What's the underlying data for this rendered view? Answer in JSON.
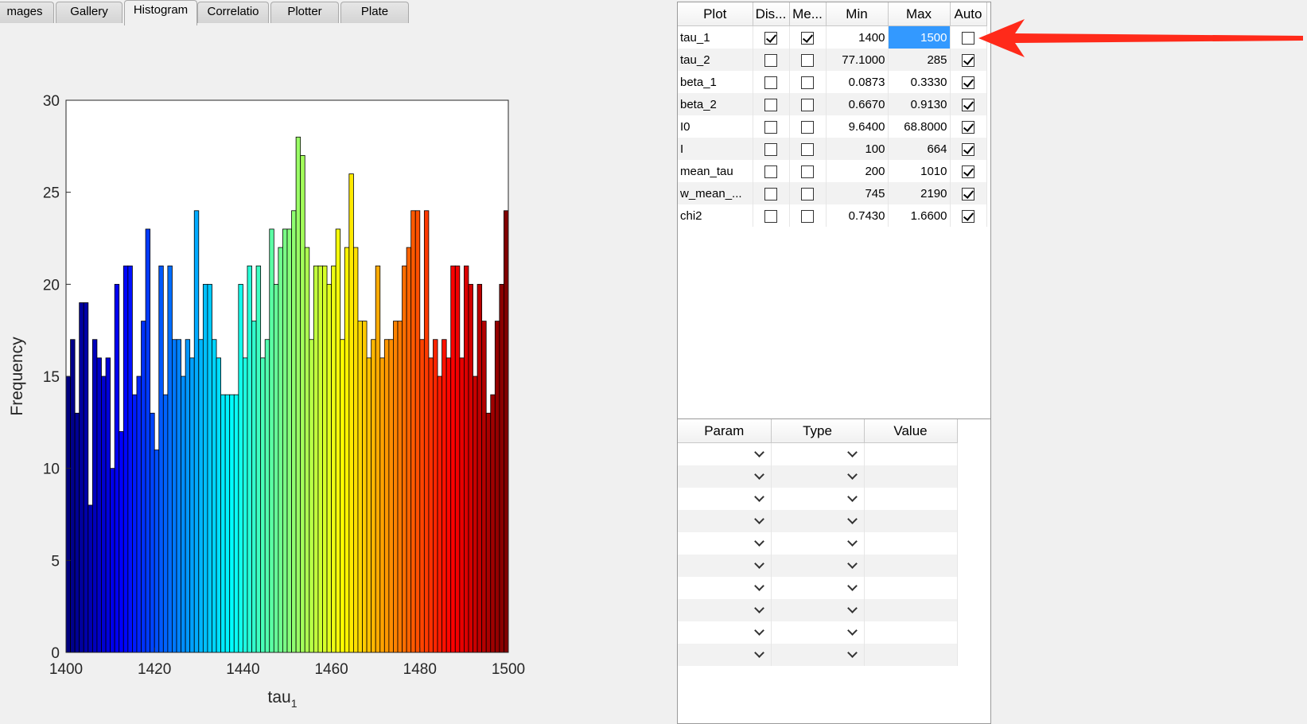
{
  "tabs": [
    {
      "label": "mages",
      "active": false
    },
    {
      "label": "Gallery",
      "active": false
    },
    {
      "label": "Histogram",
      "active": true
    },
    {
      "label": "Correlatio",
      "active": false
    },
    {
      "label": "Plotter",
      "active": false
    },
    {
      "label": "Plate",
      "active": false
    }
  ],
  "chart_data": {
    "type": "bar",
    "xlabel": "tau",
    "xlabel_subscript": "1",
    "ylabel": "Frequency",
    "xlim": [
      1400,
      1500
    ],
    "ylim": [
      0,
      30
    ],
    "xticks": [
      "1400",
      "1420",
      "1440",
      "1460",
      "1480",
      "1500"
    ],
    "yticks": [
      "0",
      "5",
      "10",
      "15",
      "20",
      "25",
      "30"
    ],
    "colormap": "jet",
    "bin_width": 1,
    "bin_start": 1400,
    "values": [
      15,
      17,
      13,
      19,
      19,
      8,
      17,
      16,
      15,
      16,
      10,
      20,
      12,
      21,
      21,
      14,
      15,
      18,
      23,
      13,
      11,
      21,
      14,
      21,
      17,
      17,
      15,
      17,
      16,
      24,
      17,
      20,
      20,
      17,
      16,
      14,
      14,
      14,
      14,
      20,
      16,
      21,
      18,
      21,
      16,
      17,
      23,
      20,
      22,
      23,
      23,
      24,
      28,
      27,
      22,
      17,
      21,
      21,
      21,
      20,
      21,
      23,
      17,
      22,
      26,
      22,
      18,
      18,
      16,
      17,
      21,
      16,
      17,
      17,
      18,
      18,
      21,
      22,
      24,
      24,
      17,
      24,
      16,
      17,
      15,
      17,
      16,
      21,
      21,
      16,
      21,
      20,
      15,
      20,
      18,
      13,
      14,
      18,
      20,
      24
    ]
  },
  "param_table": {
    "headers": [
      "Plot",
      "Dis...",
      "Me...",
      "Min",
      "Max",
      "Auto"
    ],
    "rows": [
      {
        "name": "tau_1",
        "display": true,
        "mean": true,
        "min": "1400",
        "max": "1500",
        "auto": false
      },
      {
        "name": "tau_2",
        "display": false,
        "mean": false,
        "min": "77.1000",
        "max": "285",
        "auto": true
      },
      {
        "name": "beta_1",
        "display": false,
        "mean": false,
        "min": "0.0873",
        "max": "0.3330",
        "auto": true
      },
      {
        "name": "beta_2",
        "display": false,
        "mean": false,
        "min": "0.6670",
        "max": "0.9130",
        "auto": true
      },
      {
        "name": "I0",
        "display": false,
        "mean": false,
        "min": "9.6400",
        "max": "68.8000",
        "auto": true
      },
      {
        "name": "I",
        "display": false,
        "mean": false,
        "min": "100",
        "max": "664",
        "auto": true
      },
      {
        "name": "mean_tau",
        "display": false,
        "mean": false,
        "min": "200",
        "max": "1010",
        "auto": true
      },
      {
        "name": "w_mean_...",
        "display": false,
        "mean": false,
        "min": "745",
        "max": "2190",
        "auto": true
      },
      {
        "name": "chi2",
        "display": false,
        "mean": false,
        "min": "0.7430",
        "max": "1.6600",
        "auto": true
      }
    ]
  },
  "filter_table": {
    "headers": [
      "Param",
      "Type",
      "Value"
    ],
    "row_count": 10
  },
  "colors": {
    "selection": "#3399ff",
    "annotation_arrow": "#ff2a1a"
  }
}
